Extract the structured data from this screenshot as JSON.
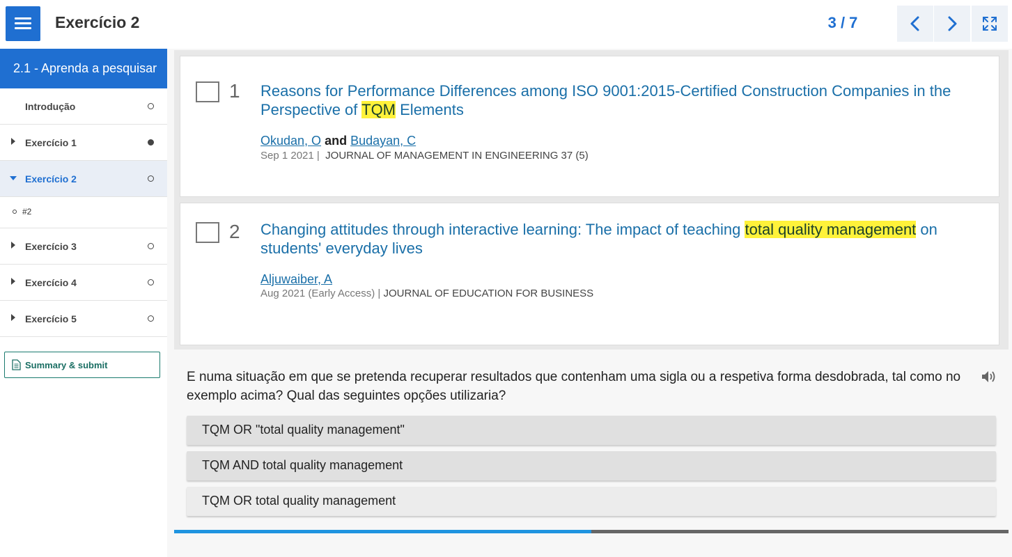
{
  "header": {
    "menu_icon": "hamburger-menu-icon",
    "title": "Exercício 2",
    "counter": "3 / 7",
    "prev_icon": "chevron-left-icon",
    "next_icon": "chevron-right-icon",
    "fullscreen_icon": "expand-icon",
    "accent_color": "#1f6fd1"
  },
  "sidebar": {
    "section_title": "2.1 - Aprenda a pesquisar",
    "items": [
      {
        "label": "Introdução",
        "status": "empty"
      },
      {
        "label": "Exercício 1",
        "status": "filled"
      },
      {
        "label": "Exercício 2",
        "status": "empty",
        "expanded": true,
        "active": true
      },
      {
        "label": "Exercício 3",
        "status": "empty"
      },
      {
        "label": "Exercício 4",
        "status": "empty"
      },
      {
        "label": "Exercício 5",
        "status": "empty"
      }
    ],
    "sub_items": [
      {
        "label": "#2"
      }
    ],
    "summary_button": "Summary & submit"
  },
  "results": [
    {
      "number": "1",
      "title_before": "Reasons for Performance Differences among ISO 9001:2015-Certified Construction Companies in the Perspective of ",
      "title_highlight": "TQM",
      "title_after": " Elements",
      "author1": "Okudan, O",
      "author_joiner": "and",
      "author2": "Budayan, C",
      "date": "Sep 1 2021 |",
      "journal": "JOURNAL OF MANAGEMENT IN ENGINEERING 37 (5)"
    },
    {
      "number": "2",
      "title_before": "Changing attitudes through interactive learning: The impact of teaching ",
      "title_highlight": "total quality management",
      "title_after": " on students' everyday lives",
      "author1": "Aljuwaiber, A",
      "date": "Aug 2021 (Early Access) |",
      "journal": "JOURNAL OF EDUCATION FOR BUSINESS"
    }
  ],
  "question": {
    "text": "E numa situação em que se pretenda recuperar resultados que contenham uma sigla ou a respetiva forma desdobrada, tal como no exemplo acima? Qual das seguintes opções utilizaria?",
    "audio_icon": "speaker-icon",
    "options": [
      "TQM OR \"total quality management\"",
      "TQM AND total quality management",
      "TQM OR total quality management"
    ]
  },
  "progress": {
    "fraction": 0.5,
    "fill_color": "#1f94e0",
    "track_color": "#666666"
  },
  "highlight_color": "#fff23a"
}
